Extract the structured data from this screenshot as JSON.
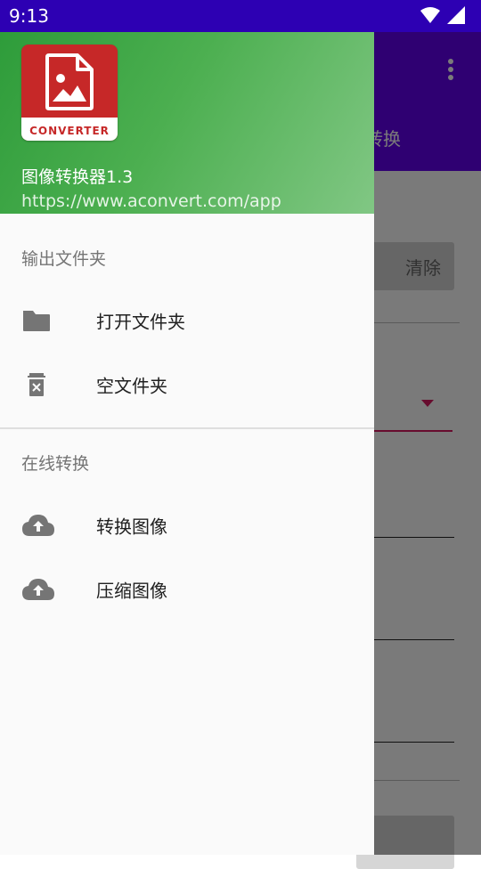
{
  "status_bar": {
    "time": "9:13"
  },
  "background_app": {
    "partial_tab_label": "转换",
    "clear_button_label": "清除"
  },
  "drawer": {
    "header": {
      "logo_text": "CONVERTER",
      "app_title": "图像转换器1.3",
      "url": "https://www.aconvert.com/app"
    },
    "sections": [
      {
        "label": "输出文件夹",
        "items": [
          {
            "label": "打开文件夹",
            "icon": "folder-icon"
          },
          {
            "label": "空文件夹",
            "icon": "trash-icon"
          }
        ]
      },
      {
        "label": "在线转换",
        "items": [
          {
            "label": "转换图像",
            "icon": "cloud-upload-icon"
          },
          {
            "label": "压缩图像",
            "icon": "cloud-upload-icon"
          }
        ]
      }
    ]
  },
  "colors": {
    "status_bar": "#2d00b3",
    "app_bar": "#6200ee",
    "header_green": "#4caf50",
    "logo_red": "#c62828",
    "accent_pink": "#d81b60"
  }
}
